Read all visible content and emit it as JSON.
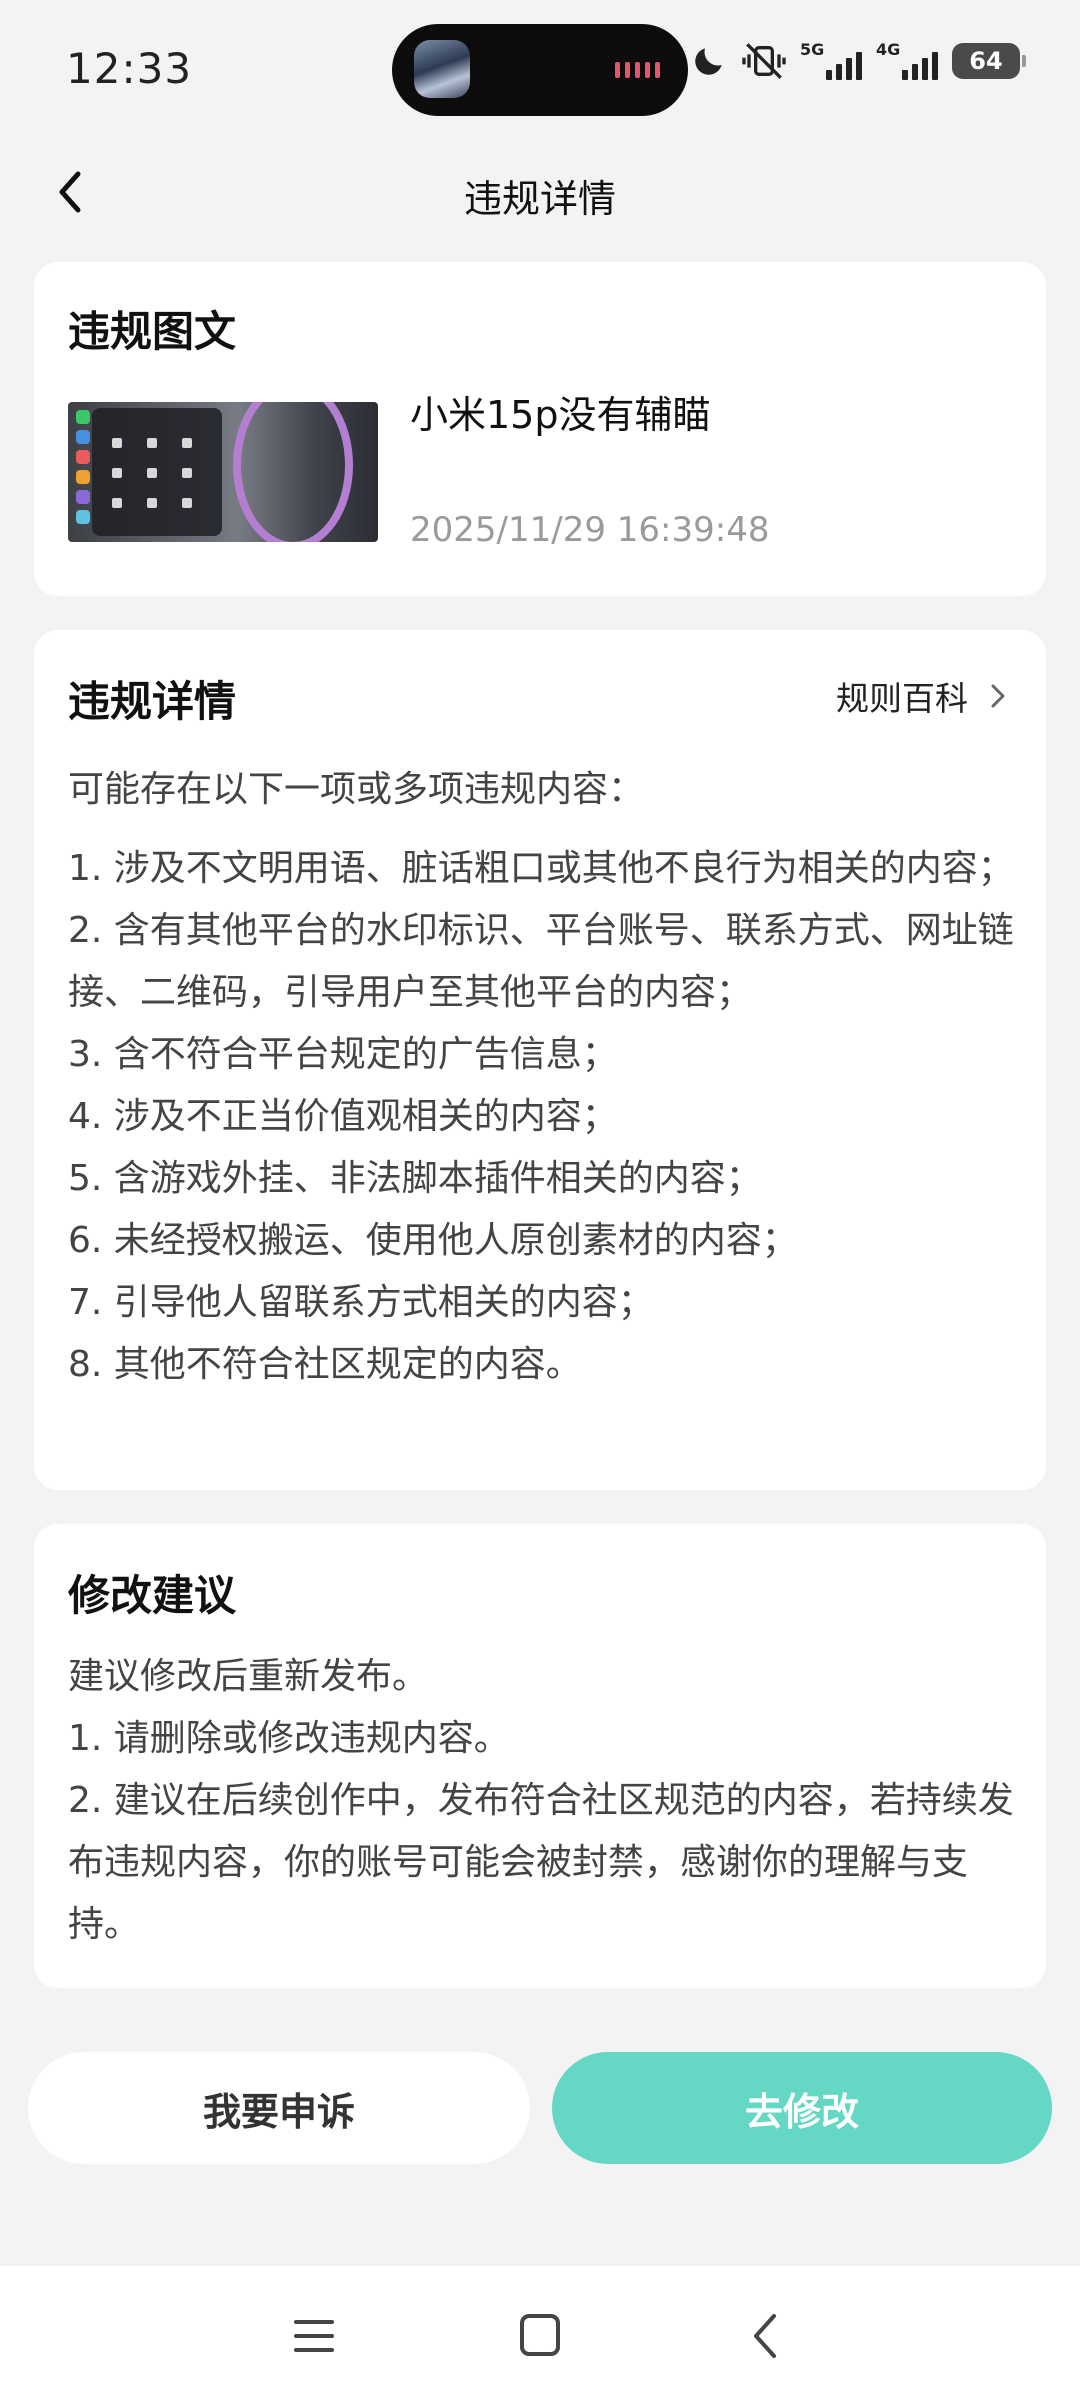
{
  "status_bar": {
    "time": "12:33",
    "network_1": "5G",
    "network_2": "4G",
    "battery": "64",
    "icons": [
      "moon-icon",
      "vibrate-off-icon",
      "signal-5g-icon",
      "signal-4g-icon",
      "battery-icon"
    ]
  },
  "header": {
    "title": "违规详情",
    "back_icon": "chevron-left-icon"
  },
  "violation_post": {
    "section_title": "违规图文",
    "post_title": "小米15p没有辅瞄",
    "timestamp": "2025/11/29 16:39:48"
  },
  "violation_details": {
    "section_title": "违规详情",
    "rules_link": "规则百科",
    "intro": "可能存在以下一项或多项违规内容：",
    "items": [
      "1. 涉及不文明用语、脏话粗口或其他不良行为相关的内容；",
      "2. 含有其他平台的水印标识、平台账号、联系方式、网址链接、二维码，引导用户至其他平台的内容；",
      "3. 含不符合平台规定的广告信息；",
      "4. 涉及不正当价值观相关的内容；",
      "5. 含游戏外挂、非法脚本插件相关的内容；",
      "6. 未经授权搬运、使用他人原创素材的内容；",
      "7. 引导他人留联系方式相关的内容；",
      "8. 其他不符合社区规定的内容。"
    ]
  },
  "suggestions": {
    "section_title": "修改建议",
    "lines": [
      "建议修改后重新发布。",
      "1. 请删除或修改违规内容。",
      "2. 建议在后续创作中，发布符合社区规范的内容，若持续发布违规内容，你的账号可能会被封禁，感谢你的理解与支持。"
    ]
  },
  "actions": {
    "appeal": "我要申诉",
    "edit": "去修改",
    "edit_color": "#64d7c5"
  },
  "nav_bar": {
    "icons": [
      "menu-icon",
      "home-icon",
      "back-icon"
    ]
  }
}
